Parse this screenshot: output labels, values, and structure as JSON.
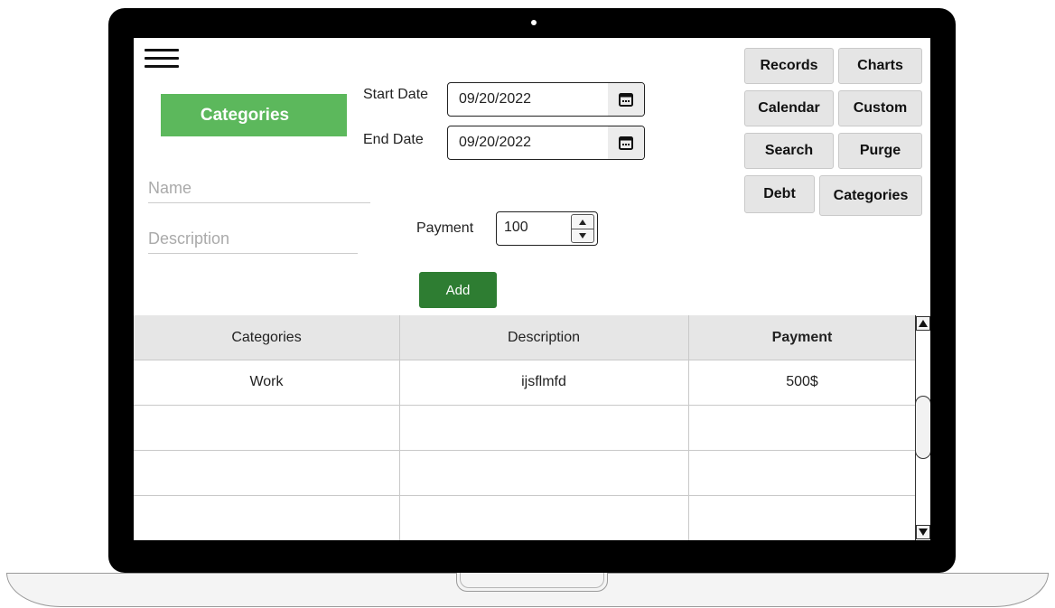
{
  "header": {
    "title": "Categories"
  },
  "dates": {
    "start_label": "Start Date",
    "start_value": "09/20/2022",
    "end_label": "End Date",
    "end_value": "09/20/2022"
  },
  "form": {
    "name_placeholder": "Name",
    "description_placeholder": "Description",
    "payment_label": "Payment",
    "payment_value": "100",
    "add_label": "Add"
  },
  "nav": {
    "records": "Records",
    "charts": "Charts",
    "calendar": "Calendar",
    "custom": "Custom",
    "search": "Search",
    "purge": "Purge",
    "debt": "Debt",
    "categories": "Categories"
  },
  "table": {
    "headers": [
      "Categories",
      "Description",
      "Payment"
    ],
    "rows": [
      [
        "Work",
        "ijsflmfd",
        "500$"
      ],
      [
        "",
        "",
        ""
      ],
      [
        "",
        "",
        ""
      ],
      [
        "",
        "",
        ""
      ]
    ]
  },
  "icons": {
    "menu": "hamburger-menu-icon",
    "calendar": "calendar-icon",
    "spin_up": "spin-up-icon",
    "spin_down": "spin-down-icon",
    "scroll_up": "scroll-up-arrow-icon",
    "scroll_down": "scroll-down-arrow-icon"
  },
  "colors": {
    "title_badge": "#5cb85c",
    "add_button": "#2e7d32",
    "nav_button": "#e5e5e5",
    "table_header": "#e6e6e6"
  }
}
